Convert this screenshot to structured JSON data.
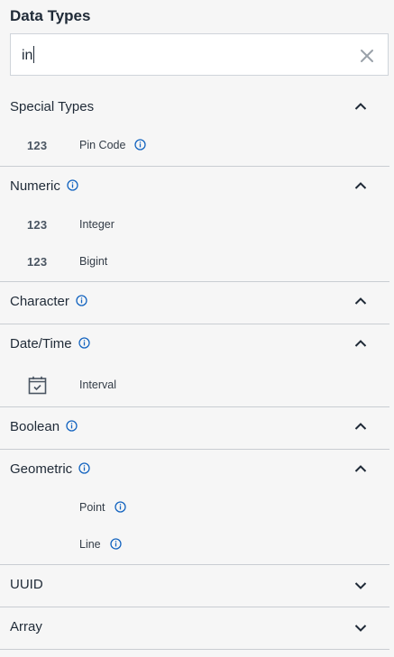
{
  "header": {
    "title": "Data Types"
  },
  "search": {
    "value": "in"
  },
  "colors": {
    "accent": "#1565c0",
    "text": "#1f2a37",
    "divider": "#c9cdd2"
  },
  "sections": [
    {
      "title": "Special Types",
      "expanded": true,
      "items": [
        {
          "icon": "123",
          "label": "Pin Code"
        }
      ]
    },
    {
      "title": "Numeric",
      "expanded": true,
      "items": [
        {
          "icon": "123",
          "label": "Integer"
        },
        {
          "icon": "123",
          "label": "Bigint"
        }
      ]
    },
    {
      "title": "Character",
      "expanded": true,
      "items": []
    },
    {
      "title": "Date/Time",
      "expanded": true,
      "items": [
        {
          "icon": "calendar-icon",
          "label": "Interval"
        }
      ]
    },
    {
      "title": "Boolean",
      "expanded": true,
      "items": []
    },
    {
      "title": "Geometric",
      "expanded": true,
      "items": [
        {
          "label": "Point"
        },
        {
          "label": "Line"
        }
      ]
    },
    {
      "title": "UUID",
      "expanded": false,
      "items": []
    },
    {
      "title": "Array",
      "expanded": false,
      "items": []
    }
  ]
}
